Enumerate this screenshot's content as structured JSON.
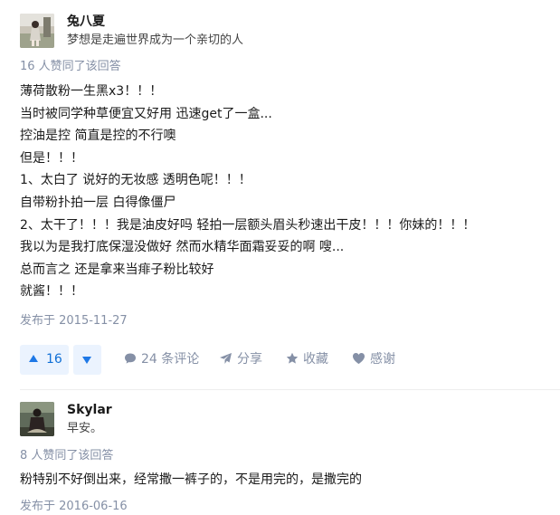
{
  "answers": [
    {
      "author": {
        "name": "兔八夏",
        "bio": "梦想是走遍世界成为一个亲切的人"
      },
      "upvote_text": "16 人赞同了该回答",
      "paragraphs": [
        "薄荷散粉一生黑x3！！！",
        "当时被同学种草便宜又好用 迅速get了一盒...",
        "控油是控 简直是控的不行噢",
        "但是！！！",
        "1、太白了 说好的无妆感 透明色呢！！！",
        "自带粉扑拍一层 白得像僵尸",
        "2、太干了！！！我是油皮好吗 轻拍一层额头眉头秒速出干皮！！！你妹的！！！",
        "我以为是我打底保湿没做好 然而水精华面霜妥妥的啊 嗖...",
        "总而言之 还是拿来当痱子粉比较好",
        "就酱！！！"
      ],
      "date": "发布于 2015-11-27",
      "actions": {
        "upvote_count": "16",
        "comments": "24 条评论",
        "share": "分享",
        "favorite": "收藏",
        "thanks": "感谢"
      }
    },
    {
      "author": {
        "name": "Skylar",
        "bio": "早安。"
      },
      "upvote_text": "8 人赞同了该回答",
      "paragraphs": [
        "粉特别不好倒出来，经常撒一裤子的，不是用完的，是撒完的"
      ],
      "date": "发布于 2016-06-16"
    }
  ],
  "colors": {
    "vote_bg": "#ebf3fe",
    "vote_fg": "#1e78e6",
    "meta": "#8590a6",
    "text": "#1a1a1a"
  }
}
